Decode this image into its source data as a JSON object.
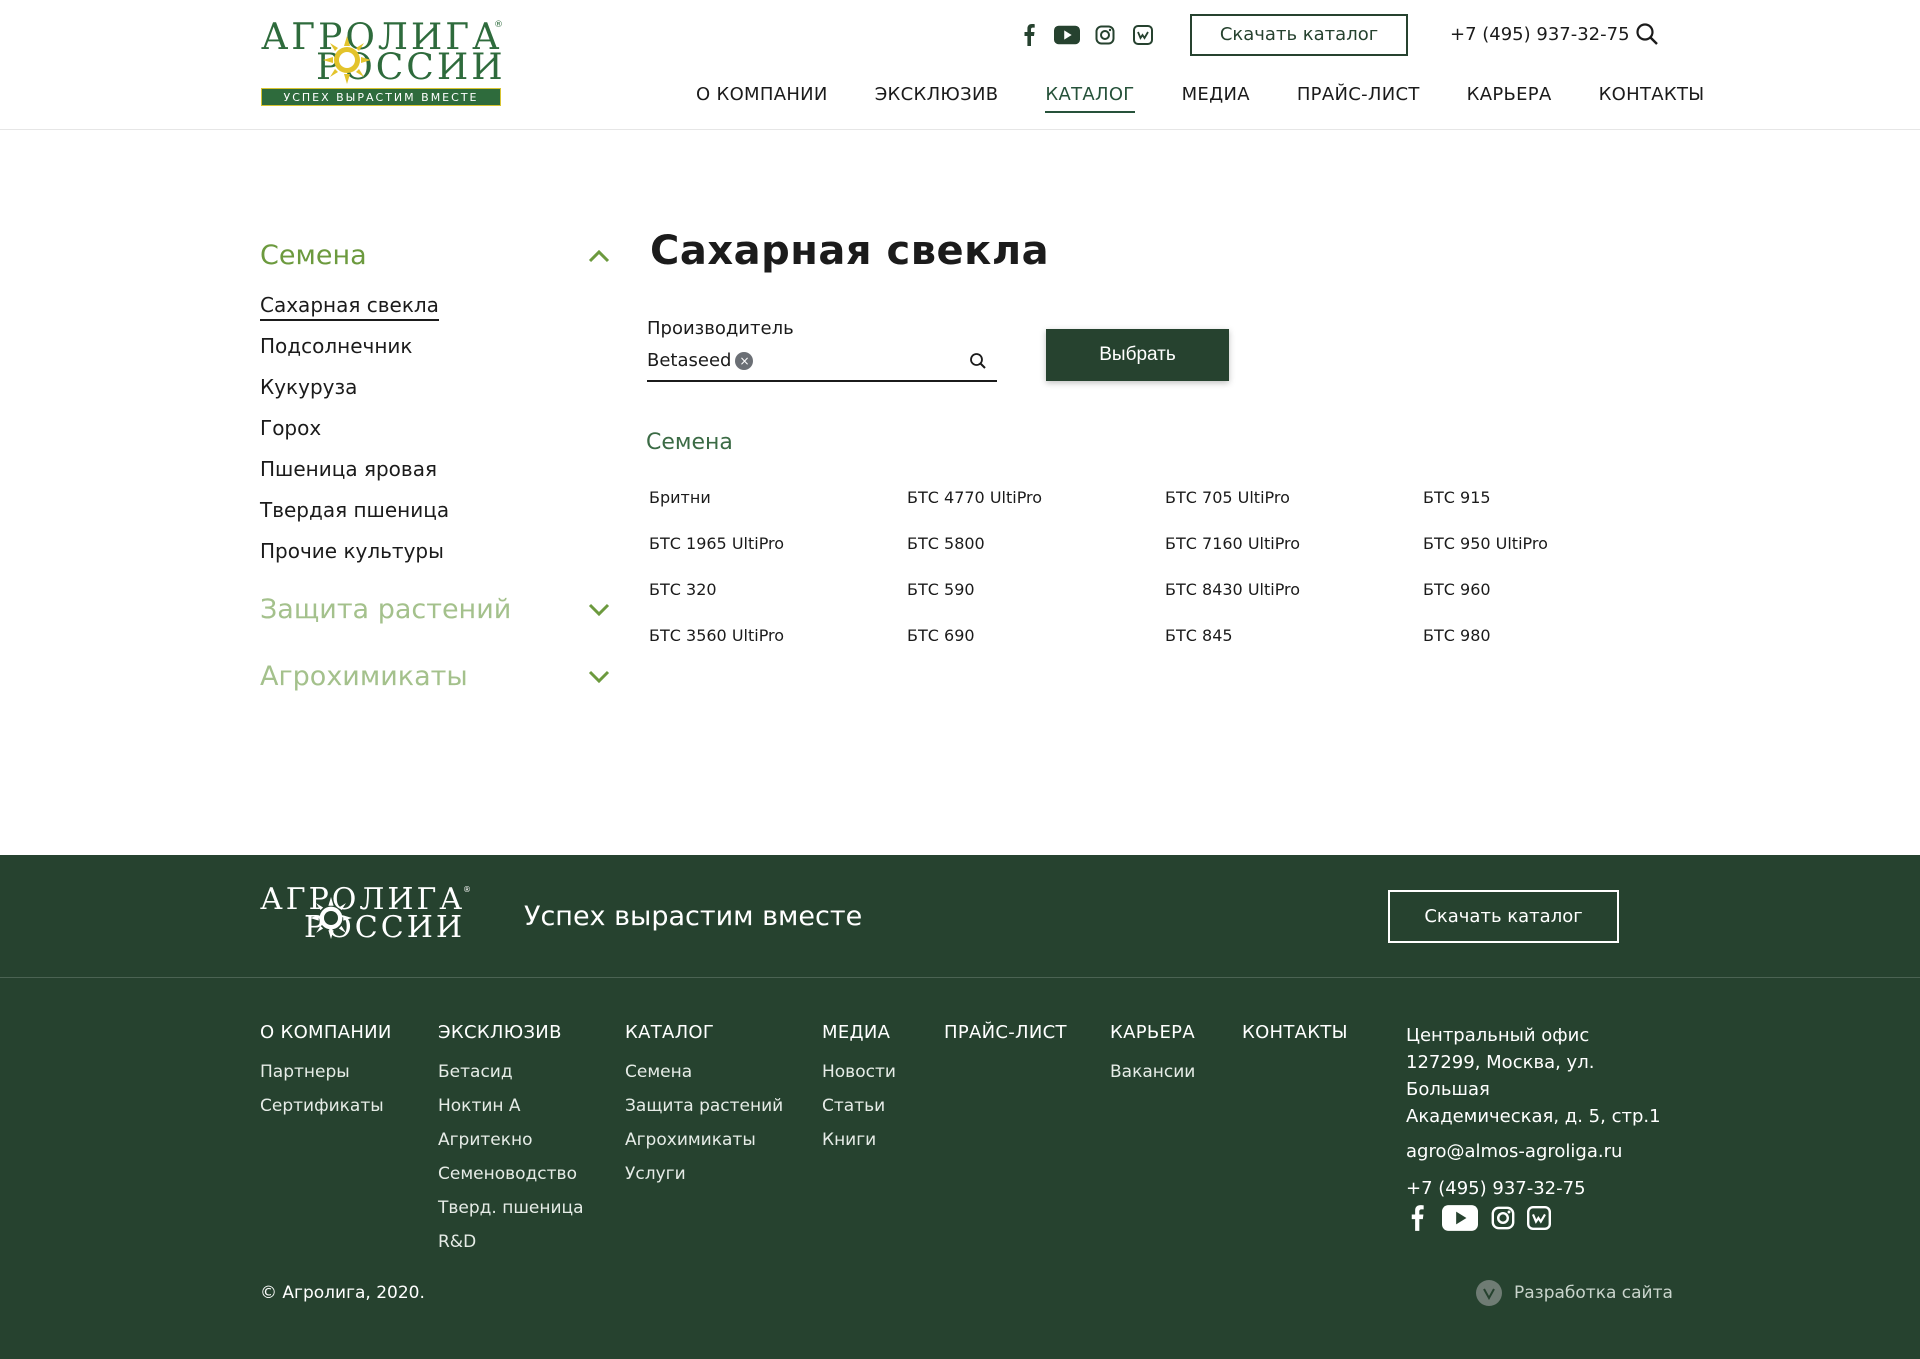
{
  "header": {
    "logo": {
      "line1": "АГРОЛИГА",
      "line2": "РОССИИ",
      "slogan": "УСПЕХ ВЫРАСТИМ ВМЕСТЕ",
      "reg": "®"
    },
    "socials": [
      "facebook-icon",
      "youtube-icon",
      "instagram-icon",
      "vk-icon"
    ],
    "catalog_button": "Скачать каталог",
    "phone": "+7 (495) 937-32-75",
    "nav": [
      "О КОМПАНИИ",
      "ЭКСКЛЮЗИВ",
      "КАТАЛОГ",
      "МЕДИА",
      "ПРАЙС-ЛИСТ",
      "КАРЬЕРА",
      "КОНТАКТЫ"
    ],
    "active_nav": "КАТАЛОГ"
  },
  "sidebar": {
    "categories": [
      {
        "label": "Семена",
        "state": "open",
        "items": [
          "Сахарная свекла",
          "Подсолнечник",
          "Кукуруза",
          "Горох",
          "Пшеница яровая",
          "Твердая пшеница",
          "Прочие культуры"
        ],
        "active_item": "Сахарная свекла"
      },
      {
        "label": "Защита растений",
        "state": "closed"
      },
      {
        "label": "Агрохимикаты",
        "state": "closed"
      }
    ]
  },
  "main": {
    "title": "Сахарная свекла",
    "filter": {
      "label": "Производитель",
      "tag": "Betaseed",
      "tag_remove": "×"
    },
    "select_button": "Выбрать",
    "section_title": "Семена",
    "products": [
      "Бритни",
      "БТС 4770 UltiPro",
      "БТС 705 UltiPro",
      "БТС 915",
      "БТС 1965 UltiPro",
      "БТС 5800",
      "БТС 7160 UltiPro",
      "БТС 950 UltiPro",
      "БТС 320",
      "БТС 590",
      "БТС 8430 UltiPro",
      "БТС 960",
      "БТС 3560 UltiPro",
      "БТС 690",
      "БТС 845",
      "БТС 980"
    ]
  },
  "footer": {
    "logo": {
      "line1": "АГРОЛИГА",
      "line2": "РОССИИ",
      "reg": "®"
    },
    "slogan": "Успех вырастим вместе",
    "catalog_button": "Скачать каталог",
    "columns": [
      {
        "title": "О КОМПАНИИ",
        "items": [
          "Партнеры",
          "Сертификаты"
        ]
      },
      {
        "title": "ЭКСКЛЮЗИВ",
        "items": [
          "Бетасид",
          "Ноктин А",
          "Агритекно",
          "Семеноводство",
          "Тверд. пшеница",
          "R&D"
        ]
      },
      {
        "title": "КАТАЛОГ",
        "items": [
          "Семена",
          "Защита растений",
          "Агрохимикаты",
          "Услуги"
        ]
      },
      {
        "title": "МЕДИА",
        "items": [
          "Новости",
          "Статьи",
          "Книги"
        ]
      },
      {
        "title": "ПРАЙС-ЛИСТ",
        "items": []
      },
      {
        "title": "КАРЬЕРА",
        "items": [
          "Вакансии"
        ]
      },
      {
        "title": "КОНТАКТЫ",
        "items": []
      }
    ],
    "office": {
      "line1": "Центральный офис",
      "line2": "127299, Москва, ул. Большая",
      "line3": "Академическая, д. 5, стр.1",
      "email": "agro@almos-agroliga.ru",
      "phone": "+7 (495) 937-32-75"
    },
    "socials": [
      "facebook-icon",
      "youtube-icon",
      "instagram-icon",
      "vk-icon"
    ],
    "copyright": "© Агролига, 2020.",
    "developer": "Разработка сайта"
  },
  "colors": {
    "brand_dark": "#26422f",
    "brand_green": "#2e6b3c",
    "accent_light": "#6c9a3e",
    "accent_muted": "#a4c18c"
  }
}
